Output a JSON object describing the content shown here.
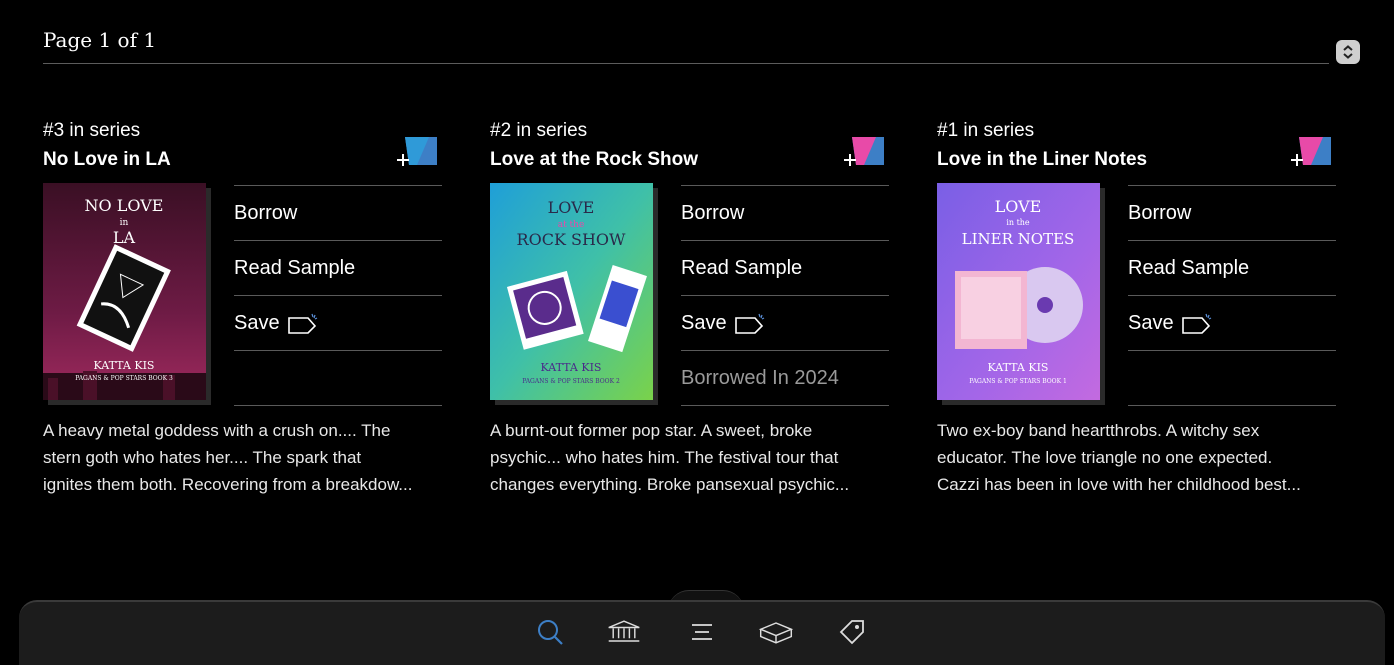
{
  "header": {
    "page_label": "Page 1 of 1"
  },
  "books": [
    {
      "series_label": "#3 in series",
      "title": "No Love in LA",
      "cover": {
        "line1": "NO LOVE",
        "line2": "in",
        "line3": "LA",
        "author": "KATTA KIS",
        "series_text": "PAGANS & POP STARS BOOK 3"
      },
      "actions": [
        "Borrow",
        "Read Sample",
        "Save"
      ],
      "status": "",
      "description": [
        "A heavy metal goddess with a crush on.... The",
        "stern goth who hates her.... The spark that",
        "ignites them both. Recovering from a breakdow..."
      ]
    },
    {
      "series_label": "#2 in series",
      "title": "Love at the Rock Show",
      "cover": {
        "line1": "LOVE",
        "line2": "at the",
        "line3": "ROCK SHOW",
        "author": "KATTA KIS",
        "series_text": "PAGANS & POP STARS BOOK 2"
      },
      "actions": [
        "Borrow",
        "Read Sample",
        "Save"
      ],
      "status": "Borrowed In 2024",
      "description": [
        "A burnt-out former pop star. A sweet, broke",
        "psychic... who hates him. The festival tour that",
        "changes everything. Broke pansexual psychic..."
      ]
    },
    {
      "series_label": "#1 in series",
      "title": "Love in the Liner Notes",
      "cover": {
        "line1": "LOVE",
        "line2": "in the",
        "line3": "LINER NOTES",
        "author": "KATTA KIS",
        "series_text": "PAGANS & POP STARS BOOK 1"
      },
      "actions": [
        "Borrow",
        "Read Sample",
        "Save"
      ],
      "status": "",
      "description": [
        "Two ex-boy band heartthrobs. A witchy sex",
        "educator. The love triangle no one expected.",
        "Cazzi has been in love with her childhood best..."
      ]
    }
  ],
  "footer": {
    "icons": [
      "search-icon",
      "library-icon",
      "menu-icon",
      "shelf-icon",
      "tag-icon"
    ]
  },
  "colors": {
    "accent": "#3d7fc6",
    "wish_pink": "#e84aa8",
    "wish_blue": "#3d7fc6"
  }
}
